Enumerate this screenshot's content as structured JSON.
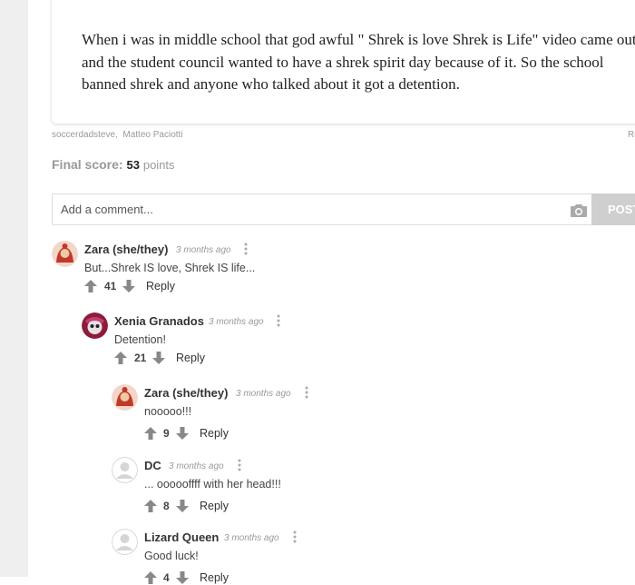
{
  "post": {
    "text": "When i was in middle school that god awful \" Shrek is love Shrek is Life\" video came out and the student council wanted to have a shrek spirit day because of it. So the school banned shrek and anyone who talked about it got a detention.",
    "credits": [
      "soccerdadsteve",
      "Matteo Paciotti"
    ],
    "credits_right": "Re"
  },
  "score": {
    "label": "Final score:",
    "value": "53",
    "unit": "points"
  },
  "comment_form": {
    "placeholder": "Add a comment...",
    "post_label": "POST"
  },
  "comments": [
    {
      "author": "Zara (she/they)",
      "time": "3 months ago",
      "text": "But...Shrek IS love, Shrek IS life...",
      "votes": "41",
      "reply_label": "Reply",
      "avatar": "zara"
    },
    {
      "author": "Xenia Granados",
      "time": "3 months ago",
      "text": "Detention!",
      "votes": "21",
      "reply_label": "Reply",
      "avatar": "xenia"
    },
    {
      "author": "Zara (she/they)",
      "time": "3 months ago",
      "text": "nooooo!!!",
      "votes": "9",
      "reply_label": "Reply",
      "avatar": "zara"
    },
    {
      "author": "DC",
      "time": "3 months ago",
      "text": "... oooooffff with her head!!!",
      "votes": "8",
      "reply_label": "Reply",
      "avatar": "default"
    },
    {
      "author": "Lizard Queen",
      "time": "3 months ago",
      "text": "Good luck!",
      "votes": "4",
      "reply_label": "Reply",
      "avatar": "default"
    }
  ],
  "colors": {
    "accent_red": "#c0392b",
    "muted": "#999999",
    "vote_gray": "#888888"
  }
}
